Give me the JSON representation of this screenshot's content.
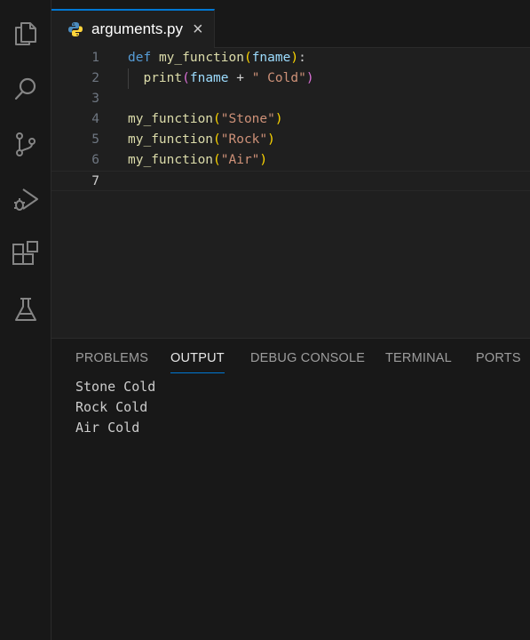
{
  "tab": {
    "filename": "arguments.py",
    "file_icon": "python-icon",
    "close_glyph": "×"
  },
  "activity_bar": [
    {
      "name": "explorer-icon"
    },
    {
      "name": "search-icon"
    },
    {
      "name": "source-control-icon"
    },
    {
      "name": "run-debug-icon"
    },
    {
      "name": "extensions-icon"
    },
    {
      "name": "testing-icon"
    }
  ],
  "editor": {
    "line_numbers": [
      "1",
      "2",
      "3",
      "4",
      "5",
      "6",
      "7"
    ],
    "current_line": "7",
    "lines": [
      [
        {
          "t": "def",
          "c": "k-kw"
        },
        {
          "t": " "
        },
        {
          "t": "my_function",
          "c": "k-fn"
        },
        {
          "t": "(",
          "c": "k-br1"
        },
        {
          "t": "fname",
          "c": "k-param"
        },
        {
          "t": ")",
          "c": "k-br1"
        },
        {
          "t": ":"
        }
      ],
      [
        {
          "t": "  "
        },
        {
          "t": "print",
          "c": "k-fn"
        },
        {
          "t": "(",
          "c": "k-br2"
        },
        {
          "t": "fname",
          "c": "k-param"
        },
        {
          "t": " + ",
          "c": "k-op"
        },
        {
          "t": "\" Cold\"",
          "c": "k-str"
        },
        {
          "t": ")",
          "c": "k-br2"
        }
      ],
      [],
      [
        {
          "t": "my_function",
          "c": "k-fn"
        },
        {
          "t": "(",
          "c": "k-br1"
        },
        {
          "t": "\"Stone\"",
          "c": "k-str"
        },
        {
          "t": ")",
          "c": "k-br1"
        }
      ],
      [
        {
          "t": "my_function",
          "c": "k-fn"
        },
        {
          "t": "(",
          "c": "k-br1"
        },
        {
          "t": "\"Rock\"",
          "c": "k-str"
        },
        {
          "t": ")",
          "c": "k-br1"
        }
      ],
      [
        {
          "t": "my_function",
          "c": "k-fn"
        },
        {
          "t": "(",
          "c": "k-br1"
        },
        {
          "t": "\"Air\"",
          "c": "k-str"
        },
        {
          "t": ")",
          "c": "k-br1"
        }
      ],
      []
    ]
  },
  "panel": {
    "tabs": [
      "PROBLEMS",
      "OUTPUT",
      "DEBUG CONSOLE",
      "TERMINAL",
      "PORTS"
    ],
    "active_tab": "OUTPUT",
    "output_lines": [
      "Stone Cold",
      "Rock Cold",
      "Air Cold"
    ]
  },
  "colors": {
    "accent": "#0078d4",
    "editor_bg": "#1f1f1f",
    "sidebar_bg": "#181818"
  }
}
